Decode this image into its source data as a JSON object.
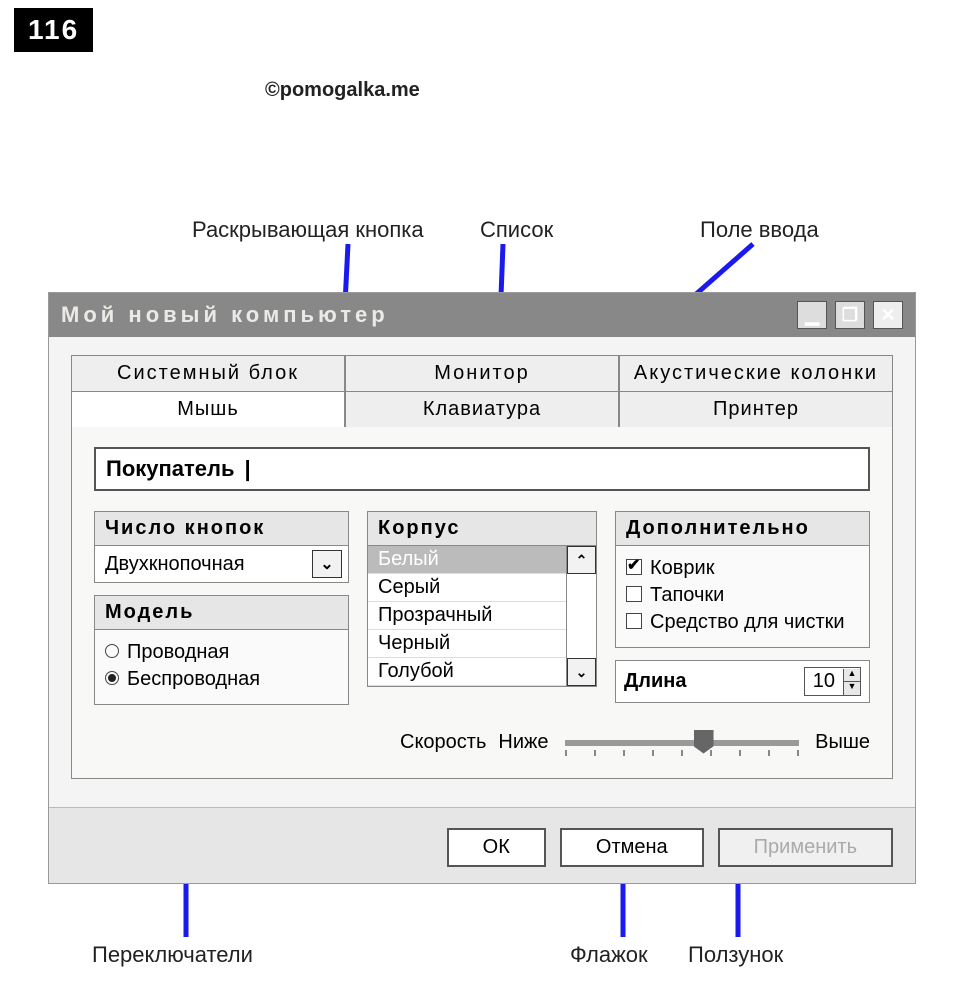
{
  "page_number": "116",
  "copyright": "©pomogalka.me",
  "annotations": {
    "dropdown_button": "Раскрывающая кнопка",
    "list": "Список",
    "input_field": "Поле ввода",
    "radio_buttons": "Переключатели",
    "checkbox": "Флажок",
    "slider": "Ползунок"
  },
  "window": {
    "title": "Мой  новый  компьютер",
    "controls": {
      "minimize": "_",
      "maximize": "❐",
      "close": "✕"
    },
    "tabs_row1": [
      "Системный  блок",
      "Монитор",
      "Акустические  колонки"
    ],
    "tabs_row2": [
      "Мышь",
      "Клавиатура",
      "Принтер"
    ],
    "active_tab": "Мышь",
    "buyer_label": "Покупатель",
    "buyer_value": "",
    "groups": {
      "button_count": {
        "title": "Число  кнопок",
        "value": "Двухкнопочная"
      },
      "model": {
        "title": "Модель",
        "options": [
          "Проводная",
          "Беспроводная"
        ],
        "selected": "Беспроводная"
      },
      "body": {
        "title": "Корпус",
        "items": [
          "Белый",
          "Серый",
          "Прозрачный",
          "Черный",
          "Голубой"
        ],
        "selected": "Белый"
      },
      "extra": {
        "title": "Дополнительно",
        "items": [
          {
            "label": "Коврик",
            "checked": true
          },
          {
            "label": "Тапочки",
            "checked": false
          },
          {
            "label": "Средство для чистки",
            "checked": false
          }
        ]
      },
      "length": {
        "label": "Длина",
        "value": "10"
      },
      "speed": {
        "label": "Скорость",
        "low": "Ниже",
        "high": "Выше"
      }
    },
    "buttons": {
      "ok": "ОК",
      "cancel": "Отмена",
      "apply": "Применить"
    }
  }
}
